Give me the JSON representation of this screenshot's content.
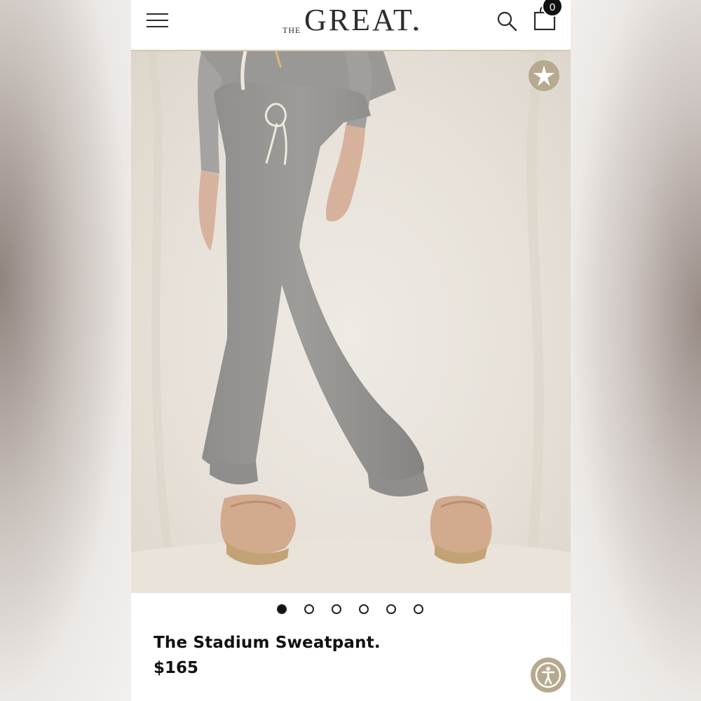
{
  "header": {
    "logo_prefix": "THE",
    "logo_main": "GREAT",
    "logo_suffix": ".",
    "logo_star": "★",
    "cart_count": "0"
  },
  "carousel": {
    "total_images": 6,
    "active_index": 1
  },
  "product": {
    "title": "The Stadium Sweatpant.",
    "price": "$165"
  },
  "icons": {
    "menu": "menu-icon",
    "search": "search-icon",
    "cart": "shopping-bag-icon",
    "badge": "star-badge-icon",
    "accessibility": "accessibility-icon"
  },
  "colors": {
    "accent_tan": "#b7a98f",
    "header_border": "#d9c8a8",
    "text": "#111111"
  }
}
